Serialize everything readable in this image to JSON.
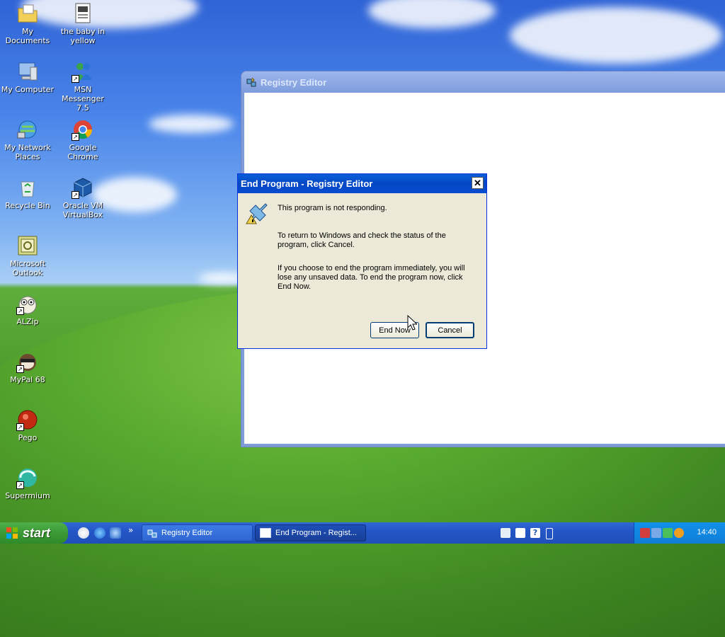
{
  "desktop_icons": [
    {
      "id": "my-documents",
      "label": "My Documents"
    },
    {
      "id": "baby-in-yellow",
      "label": "the baby in yellow"
    },
    {
      "id": "my-computer",
      "label": "My Computer"
    },
    {
      "id": "msn-messenger",
      "label": "MSN Messenger 7.5"
    },
    {
      "id": "my-network-places",
      "label": "My Network Places"
    },
    {
      "id": "google-chrome",
      "label": "Google Chrome"
    },
    {
      "id": "recycle-bin",
      "label": "Recycle Bin"
    },
    {
      "id": "oracle-vm-virtualbox",
      "label": "Oracle VM VirtualBox"
    },
    {
      "id": "microsoft-outlook",
      "label": "Microsoft Outlook"
    },
    {
      "id": "alzip",
      "label": "ALZip"
    },
    {
      "id": "mypal-68",
      "label": "MyPal 68"
    },
    {
      "id": "pego",
      "label": "Pego"
    },
    {
      "id": "supermium",
      "label": "Supermium"
    }
  ],
  "registry_window": {
    "title": "Registry Editor"
  },
  "dialog": {
    "title": "End Program - Registry Editor",
    "close_glyph": "✕",
    "message_1": "This program is not responding.",
    "message_2": "To return to Windows and check the status of the program, click Cancel.",
    "message_3": "If you choose to end the program immediately, you will lose any unsaved data. To end the program now, click End Now.",
    "end_now_label": "End Now",
    "cancel_label": "Cancel"
  },
  "taskbar": {
    "start_label": "start",
    "chevron": "»",
    "tasks": [
      {
        "label": "Registry Editor"
      },
      {
        "label": "End Program - Regist..."
      }
    ],
    "clock": "14:40"
  }
}
